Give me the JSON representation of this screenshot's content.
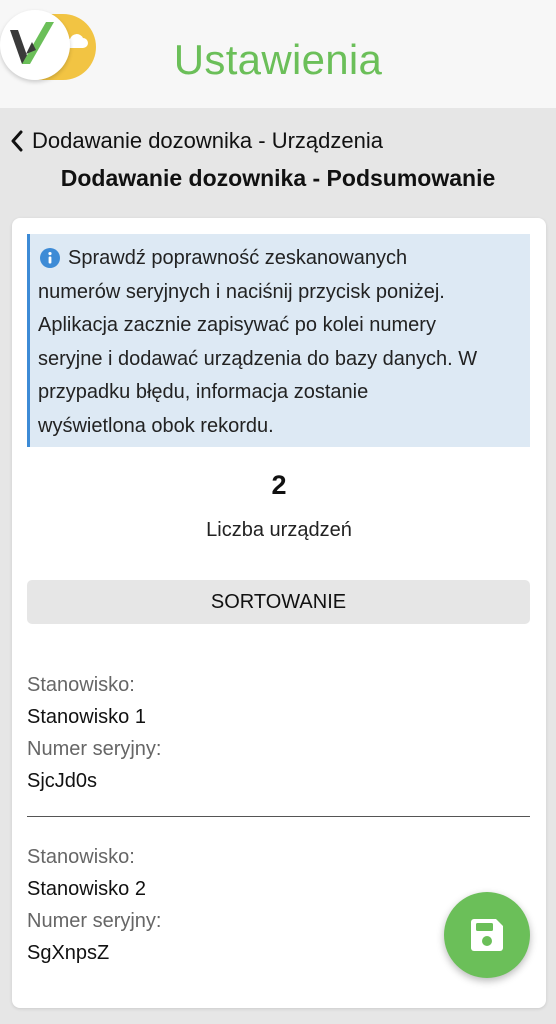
{
  "header": {
    "title": "Ustawienia",
    "logo_icon": "app-logo-icon"
  },
  "nav": {
    "back_label": "Dodawanie dozownika - Urządzenia",
    "back_icon": "chevron-left-icon"
  },
  "page": {
    "title": "Dodawanie dozownika - Podsumowanie"
  },
  "info": {
    "icon": "info-icon",
    "lines": [
      "Sprawdź poprawność zeskanowanych",
      "numerów seryjnych i naciśnij przycisk poniżej.",
      "Aplikacja zacznie zapisywać po kolei numery",
      "seryjne i dodawać urządzenia do bazy danych. W",
      "przypadku błędu, informacja zostanie",
      "wyświetlona obok rekordu."
    ]
  },
  "summary": {
    "count": "2",
    "count_label": "Liczba urządzeń"
  },
  "sort_button": {
    "label": "SORTOWANIE"
  },
  "records": [
    {
      "station_label": "Stanowisko:",
      "station_value": "Stanowisko 1",
      "serial_label": "Numer seryjny:",
      "serial_value": "SjcJd0s"
    },
    {
      "station_label": "Stanowisko:",
      "station_value": "Stanowisko 2",
      "serial_label": "Numer seryjny:",
      "serial_value": "SgXnpsZ"
    }
  ],
  "fab": {
    "icon": "save-icon"
  },
  "colors": {
    "accent": "#6bbf59",
    "info_bg": "#dde9f4",
    "info_border": "#3d8bd6",
    "logo_yellow": "#f2c443"
  }
}
